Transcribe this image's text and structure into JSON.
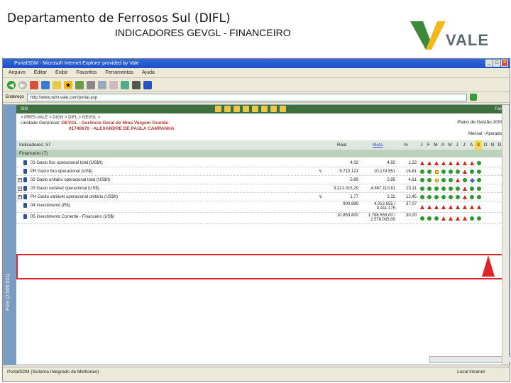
{
  "slide": {
    "title": "Departamento de Ferrosos Sul (DIFL)",
    "subtitle": "INDICADORES GEVGL - FINANCEIRO",
    "logo_text": "VALE",
    "brand_green": "#3a8a3a",
    "brand_yellow": "#f2b81c"
  },
  "browser": {
    "title": "PortalSDM - Microsoft Internet Explorer provided by Vale",
    "menu": [
      "Arquivo",
      "Editar",
      "Exibir",
      "Favoritos",
      "Ferramentas",
      "Ajuda"
    ],
    "address_label": "Endereço",
    "url": "http://www.sdm.vale.com/portal.asp",
    "status_text": "PortalSDM (Sistema Integrado de Melhorias)",
    "status_zone": "Local intranet"
  },
  "portal": {
    "nav_label": "SIG",
    "nav_right": "Farol",
    "breadcrumb": "> PRES-VALE > DIGN > DIFL > GEVGL >",
    "unit_label": "Unidade Gerencial:",
    "unit_name": "GEVGL - Gerência Geral de Mina Vargem Grande",
    "person": "01740670 - ALEXANDRE DE PAULA CAMPANHA",
    "plan": "Plano de Gestão 2009",
    "legend": "Mensal - Apurado",
    "sidebar_label": "PGV (2.500 021)",
    "indicators_label": "Indicadores: 57",
    "group_label": "Financeiro (7)",
    "col_real": "Real",
    "col_meta": "Meta",
    "col_pct": "%",
    "months": [
      "J",
      "F",
      "M",
      "A",
      "M",
      "J",
      "J",
      "A",
      "S",
      "O",
      "N",
      "D"
    ],
    "current_month_index": 8
  },
  "rows": [
    {
      "label": "01 Gasto fixo operacional total (US$/t)",
      "real": "4,02",
      "meta": "4,92",
      "pct": "1,22",
      "marks": [
        "tri",
        "tri",
        "tri",
        "tri",
        "tri",
        "tri",
        "tri",
        "tri",
        "dot"
      ],
      "expand": false,
      "flag": false,
      "tall": false
    },
    {
      "label": "PH Gasto fixo operacional (US$)",
      "real": "9.710.121",
      "meta": "10.174.551",
      "pct": "16,81",
      "marks": [
        "dot",
        "dot",
        "sq",
        "dot",
        "dot",
        "dot",
        "tri",
        "dot",
        "dot"
      ],
      "expand": false,
      "flag": true,
      "tall": false
    },
    {
      "label": "02 Gasto unitário operacional total (US$/t)",
      "real": "5,99",
      "meta": "5,95",
      "pct": "4,61",
      "marks": [
        "dot",
        "dot",
        "sq",
        "dot",
        "dot",
        "tri",
        "dot",
        "dia",
        "dot"
      ],
      "expand": true,
      "flag": false,
      "tall": false
    },
    {
      "label": "03 Gasto variável operacional (US$)",
      "real": "3.221.015,29",
      "meta": "4.867.110,81",
      "pct": "23,11",
      "marks": [
        "dot",
        "dot",
        "dot",
        "dot",
        "dot",
        "dot",
        "tri",
        "dot",
        "dot"
      ],
      "expand": true,
      "flag": false,
      "tall": false
    },
    {
      "label": "PH Gasto variável operacional unitário (US$/t)",
      "real": "1,77",
      "meta": "2,32",
      "pct": "12,45",
      "marks": [
        "dot",
        "dot",
        "dot",
        "dot",
        "dot",
        "dot",
        "tri",
        "dot",
        "dot"
      ],
      "expand": true,
      "flag": true,
      "tall": false
    },
    {
      "label": "04 Investimento (R$)",
      "real": "900.899",
      "meta": "4.012.555 / 4.411.175",
      "pct": "37,07",
      "marks": [
        "tri",
        "tri",
        "tri",
        "tri",
        "tri",
        "tri",
        "tri",
        "tri",
        "tri"
      ],
      "expand": false,
      "flag": false,
      "tall": true
    },
    {
      "label": "05 Investimento Corrente - Financeiro (US$)",
      "real": "10.853.800",
      "meta": "1.788.555,00 / 2.576.005,00",
      "pct": "30,00",
      "marks": [
        "dot",
        "dot",
        "dot",
        "tri",
        "tri",
        "tri",
        "tri",
        "dot",
        "dot"
      ],
      "expand": false,
      "flag": false,
      "tall": true
    }
  ]
}
